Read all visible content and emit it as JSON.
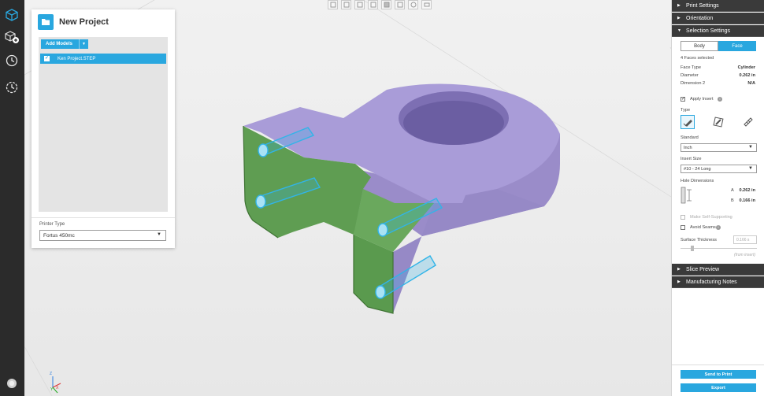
{
  "rail": {
    "items": [
      {
        "name": "cube-view-icon"
      },
      {
        "name": "add-model-icon"
      },
      {
        "name": "history-icon"
      },
      {
        "name": "timer-icon"
      }
    ]
  },
  "toolbar": {
    "views": [
      "view-front-icon",
      "view-back-icon",
      "view-left-icon",
      "view-right-icon",
      "view-top-icon",
      "view-bottom-icon",
      "view-iso-icon",
      "view-camera-icon"
    ]
  },
  "project": {
    "title": "New Project",
    "add_models_label": "Add Models",
    "model_name": "Ken Project.STEP",
    "printer_type_label": "Printer Type",
    "printer_type_value": "Fortus 450mc"
  },
  "settings": {
    "print_settings": "Print Settings",
    "orientation": "Orientation",
    "selection_settings": "Selection Settings",
    "tab_body": "Body",
    "tab_face": "Face",
    "faces_selected": "4 Faces selected",
    "face_type_label": "Face Type",
    "face_type_value": "Cylinder",
    "diameter_label": "Diameter",
    "diameter_value": "0.262 in",
    "dimension2_label": "Dimension 2",
    "dimension2_value": "N/A",
    "apply_insert_label": "Apply Insert",
    "type_label": "Type",
    "standard_label": "Standard",
    "standard_value": "Inch",
    "insert_size_label": "Insert Size",
    "insert_size_value": "#10 - 24 Long",
    "hole_dimensions_label": "Hole Dimensions",
    "hole_a_letter": "A",
    "hole_a_value": "0.262 in",
    "hole_b_letter": "B",
    "hole_b_value": "0.166 in",
    "make_self_supporting": "Make Self-Supporting",
    "avoid_seams": "Avoid Seams",
    "surface_thickness_label": "Surface Thickness",
    "surface_thickness_value": "0.166 s",
    "from_insert": "(from insert)",
    "slice_preview": "Slice Preview",
    "manufacturing_notes": "Manufacturing Notes",
    "send_to_print": "Send to Print",
    "export": "Export"
  },
  "axes": {
    "z": "Z",
    "x": "X",
    "y": "Y"
  },
  "colors": {
    "accent": "#29a7df",
    "model_top": "#a89bd6",
    "model_selected_faces": "#5f9d52",
    "holes_highlight": "#31b4e8",
    "dark_header": "#3a3a3a"
  }
}
